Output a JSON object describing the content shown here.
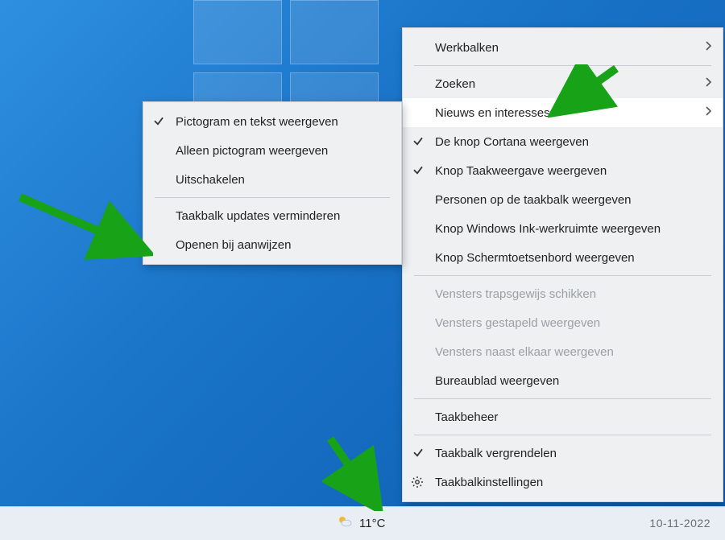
{
  "mainMenu": {
    "werkbalken": "Werkbalken",
    "zoeken": "Zoeken",
    "nieuws": "Nieuws en interesses",
    "cortana": "De knop Cortana weergeven",
    "taakweergave": "Knop Taakweergave weergeven",
    "personen": "Personen op de taakbalk weergeven",
    "ink": "Knop Windows Ink-werkruimte weergeven",
    "schermtoets": "Knop Schermtoetsenbord weergeven",
    "trapsgewijs": "Vensters trapsgewijs schikken",
    "gestapeld": "Vensters gestapeld weergeven",
    "naastelkaar": "Vensters naast elkaar weergeven",
    "bureaublad": "Bureaublad weergeven",
    "taakbeheer": "Taakbeheer",
    "vergrendelen": "Taakbalk vergrendelen",
    "instellingen": "Taakbalkinstellingen"
  },
  "subMenu": {
    "pictogramTekst": "Pictogram en tekst weergeven",
    "alleenPictogram": "Alleen pictogram weergeven",
    "uitschakelen": "Uitschakelen",
    "updates": "Taakbalk updates verminderen",
    "openen": "Openen bij aanwijzen"
  },
  "taskbar": {
    "temp": "11°C",
    "date": "10-11-2022"
  }
}
